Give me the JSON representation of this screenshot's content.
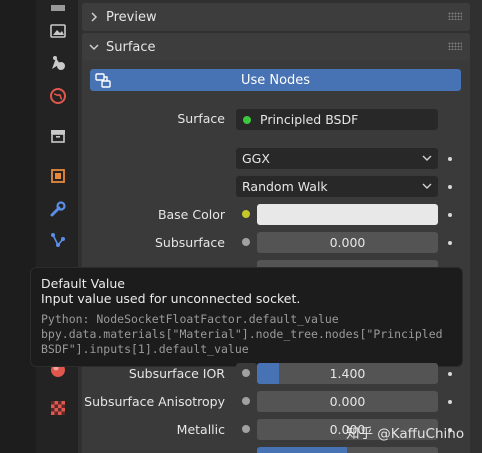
{
  "panels": {
    "preview": {
      "title": "Preview"
    },
    "surface": {
      "title": "Surface"
    }
  },
  "use_nodes_label": "Use Nodes",
  "surface_row": {
    "label": "Surface",
    "value": "Principled BSDF",
    "socket_color": "#3cc83c"
  },
  "distribution": {
    "value": "GGX"
  },
  "subsurface_method": {
    "value": "Random Walk"
  },
  "base_color": {
    "label": "Base Color",
    "socket_color": "#c7c729",
    "color": "#e8e8e8"
  },
  "subsurface": {
    "label": "Subsurface",
    "value": "0.000"
  },
  "subsurface_ior": {
    "label": "Subsurface IOR",
    "value": "1.400",
    "fill_fraction": 0.12
  },
  "subsurface_anisotropy": {
    "label": "Subsurface Anisotropy",
    "value": "0.000"
  },
  "metallic": {
    "label": "Metallic",
    "value": "0.000"
  },
  "tooltip": {
    "title": "Default Value",
    "description": "Input value used for unconnected socket.",
    "python_line1": "Python: NodeSocketFloatFactor.default_value",
    "python_line2": "bpy.data.materials[\"Material\"].node_tree.nodes[\"Principled",
    "python_line3": "BSDF\"].inputs[1].default_value"
  },
  "watermark": "知乎 @KaffuChino",
  "colors": {
    "accent": "#4772b3",
    "background": "#303030",
    "panel": "#3a3a3a"
  }
}
